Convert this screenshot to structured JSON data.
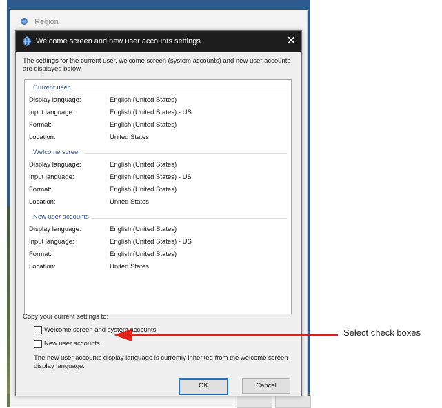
{
  "parent_window": {
    "title": "Region"
  },
  "dialog": {
    "title": "Welcome screen and new user accounts settings",
    "intro": "The settings for the current user, welcome screen (system accounts) and new user accounts are displayed below.",
    "sections": [
      {
        "heading": "Current user",
        "rows": [
          {
            "key": "Display language:",
            "value": "English (United States)"
          },
          {
            "key": "Input language:",
            "value": "English (United States) - US"
          },
          {
            "key": "Format:",
            "value": "English (United States)"
          },
          {
            "key": "Location:",
            "value": "United States"
          }
        ]
      },
      {
        "heading": "Welcome screen",
        "rows": [
          {
            "key": "Display language:",
            "value": "English (United States)"
          },
          {
            "key": "Input language:",
            "value": "English (United States) - US"
          },
          {
            "key": "Format:",
            "value": "English (United States)"
          },
          {
            "key": "Location:",
            "value": "United States"
          }
        ]
      },
      {
        "heading": "New user accounts",
        "rows": [
          {
            "key": "Display language:",
            "value": "English (United States)"
          },
          {
            "key": "Input language:",
            "value": "English (United States) - US"
          },
          {
            "key": "Format:",
            "value": "English (United States)"
          },
          {
            "key": "Location:",
            "value": "United States"
          }
        ]
      }
    ],
    "copy_label": "Copy your current settings to:",
    "checkbox_welcome": {
      "label": "Welcome screen and system accounts",
      "checked": false
    },
    "checkbox_new_user": {
      "label": "New user accounts",
      "checked": false
    },
    "note": "The new user accounts display language is currently inherited from the welcome screen display language.",
    "ok_label": "OK",
    "cancel_label": "Cancel"
  },
  "annotation": {
    "text": "Select check boxes",
    "arrow_color": "#e0201b"
  },
  "icons": {
    "dialog_icon": "globe-icon",
    "close": "close-icon"
  }
}
